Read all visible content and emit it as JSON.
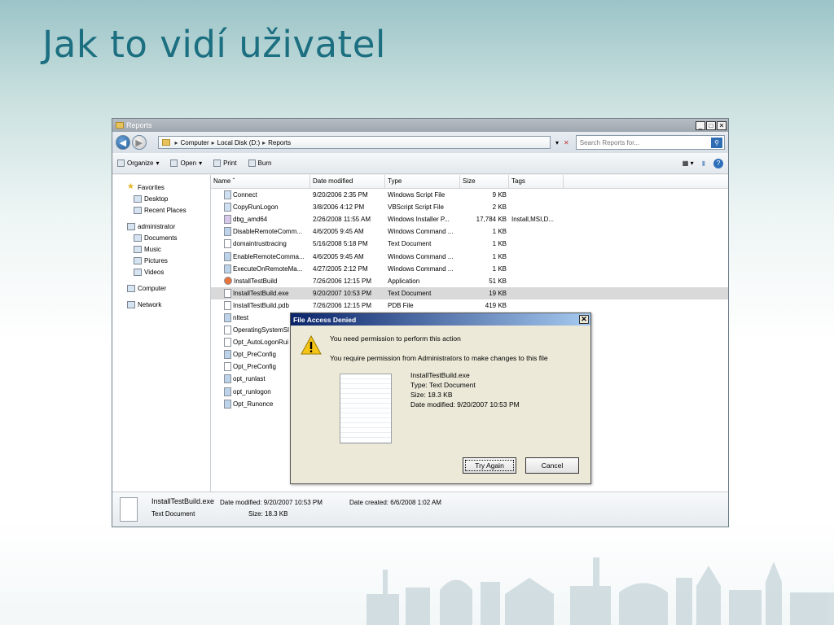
{
  "slide": {
    "title": "Jak to vidí uživatel"
  },
  "window": {
    "title": "Reports",
    "controls": {
      "minimize": "_",
      "maximize": "□",
      "close": "✕"
    },
    "address": {
      "segments": [
        "Computer",
        "Local Disk (D:)",
        "Reports"
      ]
    },
    "search": {
      "placeholder": "Search Reports for..."
    },
    "toolbar": {
      "organize": "Organize",
      "open": "Open",
      "print": "Print",
      "burn": "Burn"
    },
    "nav": {
      "favorites": "Favorites",
      "desktop": "Desktop",
      "recent": "Recent Places",
      "user": "administrator",
      "documents": "Documents",
      "music": "Music",
      "pictures": "Pictures",
      "videos": "Videos",
      "computer": "Computer",
      "network": "Network"
    },
    "columns": {
      "name": "Name",
      "date": "Date modified",
      "type": "Type",
      "size": "Size",
      "tags": "Tags"
    },
    "files": [
      {
        "name": "Connect",
        "date": "9/20/2006 2:35 PM",
        "type": "Windows Script File",
        "size": "9 KB",
        "tags": "",
        "icon": "script"
      },
      {
        "name": "CopyRunLogon",
        "date": "3/8/2006 4:12 PM",
        "type": "VBScript Script File",
        "size": "2 KB",
        "tags": "",
        "icon": "script"
      },
      {
        "name": "dbg_amd64",
        "date": "2/26/2008 11:55 AM",
        "type": "Windows Installer P...",
        "size": "17,784 KB",
        "tags": "Install,MSI,D...",
        "icon": "msi"
      },
      {
        "name": "DisableRemoteComm...",
        "date": "4/6/2005 9:45 AM",
        "type": "Windows Command ...",
        "size": "1 KB",
        "tags": "",
        "icon": "cmd"
      },
      {
        "name": "domaintrusttracing",
        "date": "5/16/2008 5:18 PM",
        "type": "Text Document",
        "size": "1 KB",
        "tags": "",
        "icon": "doc"
      },
      {
        "name": "EnableRemoteComma...",
        "date": "4/6/2005 9:45 AM",
        "type": "Windows Command ...",
        "size": "1 KB",
        "tags": "",
        "icon": "cmd"
      },
      {
        "name": "ExecuteOnRemoteMa...",
        "date": "4/27/2005 2:12 PM",
        "type": "Windows Command ...",
        "size": "1 KB",
        "tags": "",
        "icon": "cmd"
      },
      {
        "name": "InstallTestBuild",
        "date": "7/26/2006 12:15 PM",
        "type": "Application",
        "size": "51 KB",
        "tags": "",
        "icon": "app"
      },
      {
        "name": "InstallTestBuild.exe",
        "date": "9/20/2007 10:53 PM",
        "type": "Text Document",
        "size": "19 KB",
        "tags": "",
        "icon": "doc"
      },
      {
        "name": "InstallTestBuild.pdb",
        "date": "7/26/2006 12:15 PM",
        "type": "PDB File",
        "size": "419 KB",
        "tags": "",
        "icon": "pdb"
      },
      {
        "name": "nltest",
        "date": "",
        "type": "",
        "size": "",
        "tags": "",
        "icon": "cmd"
      },
      {
        "name": "OperatingSystemSl",
        "date": "",
        "type": "",
        "size": "",
        "tags": "",
        "icon": "doc"
      },
      {
        "name": "Opt_AutoLogonRui",
        "date": "",
        "type": "",
        "size": "",
        "tags": "",
        "icon": "doc"
      },
      {
        "name": "Opt_PreConfig",
        "date": "",
        "type": "",
        "size": "",
        "tags": "",
        "icon": "cmd"
      },
      {
        "name": "Opt_PreConfig",
        "date": "",
        "type": "",
        "size": "",
        "tags": "",
        "icon": "doc"
      },
      {
        "name": "opt_runlast",
        "date": "",
        "type": "",
        "size": "",
        "tags": "",
        "icon": "cmd"
      },
      {
        "name": "opt_runlogon",
        "date": "",
        "type": "",
        "size": "",
        "tags": "",
        "icon": "cmd"
      },
      {
        "name": "Opt_Runonce",
        "date": "",
        "type": "",
        "size": "",
        "tags": "",
        "icon": "cmd"
      }
    ],
    "selected_index": 8,
    "details": {
      "name": "InstallTestBuild.exe",
      "type": "Text Document",
      "modified": "Date modified: 9/20/2007 10:53 PM",
      "size": "Size: 18.3 KB",
      "created": "Date created: 6/6/2008 1:02 AM"
    }
  },
  "dialog": {
    "title": "File Access Denied",
    "close": "✕",
    "message1": "You need permission to perform this action",
    "message2": "You require permission from Administrators to make changes to this file",
    "file": {
      "name": "InstallTestBuild.exe",
      "type": "Type: Text Document",
      "size": "Size: 18.3 KB",
      "modified": "Date modified: 9/20/2007 10:53 PM"
    },
    "buttons": {
      "try_again": "Try Again",
      "cancel": "Cancel"
    }
  }
}
